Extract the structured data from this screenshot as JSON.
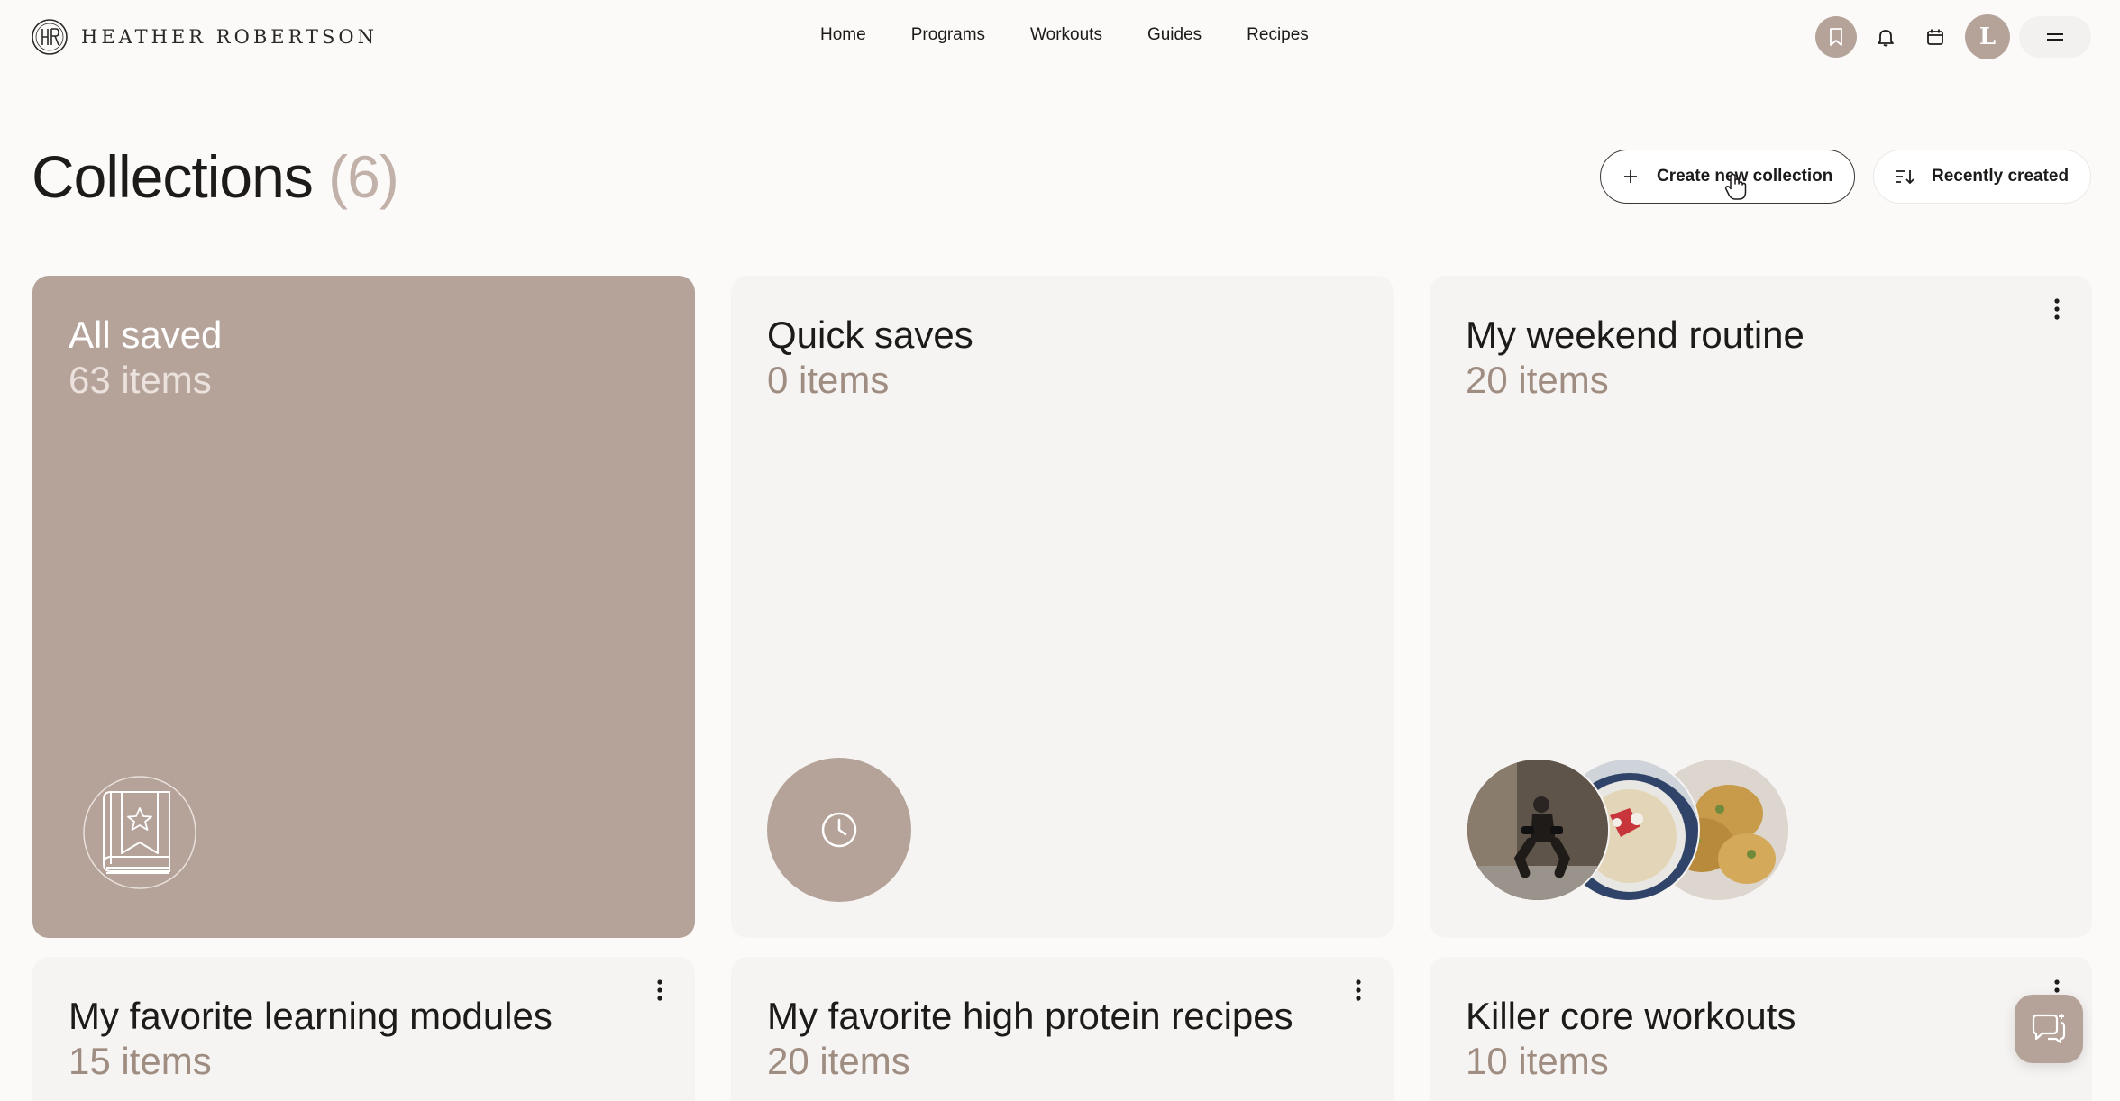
{
  "brand": {
    "name": "HEATHER ROBERTSON",
    "logo_icon": "hr-monogram-icon"
  },
  "nav": {
    "items": [
      "Home",
      "Programs",
      "Workouts",
      "Guides",
      "Recipes"
    ]
  },
  "toolbar": {
    "icons": [
      "bookmark-icon",
      "bell-icon",
      "calendar-icon",
      "hamburger-menu-icon"
    ],
    "avatar_initial": "L"
  },
  "page": {
    "title": "Collections",
    "count": "(6)",
    "create_label": "Create new collection",
    "sort_label": "Recently created"
  },
  "collections": [
    {
      "title": "All saved",
      "items": "63 items",
      "thumb": "book-star-icon"
    },
    {
      "title": "Quick saves",
      "items": "0 items",
      "thumb": "clock-icon"
    },
    {
      "title": "My weekend routine",
      "items": "20 items",
      "thumb": "photo-stack"
    },
    {
      "title": "My favorite learning modules",
      "items": "15 items"
    },
    {
      "title": "My favorite high protein recipes",
      "items": "20 items"
    },
    {
      "title": "Killer core workouts",
      "items": "10 items"
    }
  ],
  "colors": {
    "accent": "#b5a39a",
    "muted_text": "#a08d82",
    "card_bg": "#f6f4f2",
    "page_bg": "#fbfaf9"
  },
  "chat": {
    "icon": "chat-bubbles-icon"
  }
}
